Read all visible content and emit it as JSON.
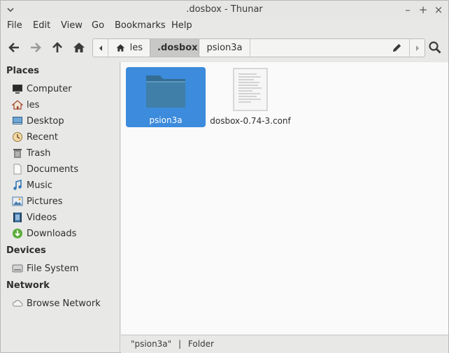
{
  "window": {
    "title": ".dosbox - Thunar"
  },
  "menu": [
    "File",
    "Edit",
    "View",
    "Go",
    "Bookmarks",
    "Help"
  ],
  "pathbar": {
    "crumbs": [
      {
        "label": "les",
        "icon": "home-icon"
      },
      {
        "label": ".dosbox",
        "active": true
      },
      {
        "label": "psion3a"
      }
    ]
  },
  "sidebar": {
    "sections": [
      {
        "title": "Places",
        "items": [
          {
            "label": "Computer",
            "icon": "computer-icon"
          },
          {
            "label": "les",
            "icon": "home-icon"
          },
          {
            "label": "Desktop",
            "icon": "desktop-icon"
          },
          {
            "label": "Recent",
            "icon": "recent-icon"
          },
          {
            "label": "Trash",
            "icon": "trash-icon"
          },
          {
            "label": "Documents",
            "icon": "documents-icon"
          },
          {
            "label": "Music",
            "icon": "music-icon"
          },
          {
            "label": "Pictures",
            "icon": "pictures-icon"
          },
          {
            "label": "Videos",
            "icon": "videos-icon"
          },
          {
            "label": "Downloads",
            "icon": "downloads-icon"
          }
        ]
      },
      {
        "title": "Devices",
        "items": [
          {
            "label": "File System",
            "icon": "drive-icon"
          }
        ]
      },
      {
        "title": "Network",
        "items": [
          {
            "label": "Browse Network",
            "icon": "cloud-icon"
          }
        ]
      }
    ]
  },
  "files": [
    {
      "name": "psion3a",
      "type": "folder",
      "selected": true
    },
    {
      "name": "dosbox-0.74-3.conf",
      "type": "text-file",
      "selected": false
    }
  ],
  "status": {
    "name": "\"psion3a\"",
    "separator": "|",
    "kind": "Folder"
  },
  "colors": {
    "selection": "#3c8bdc",
    "folder": "#3f7fa8"
  }
}
